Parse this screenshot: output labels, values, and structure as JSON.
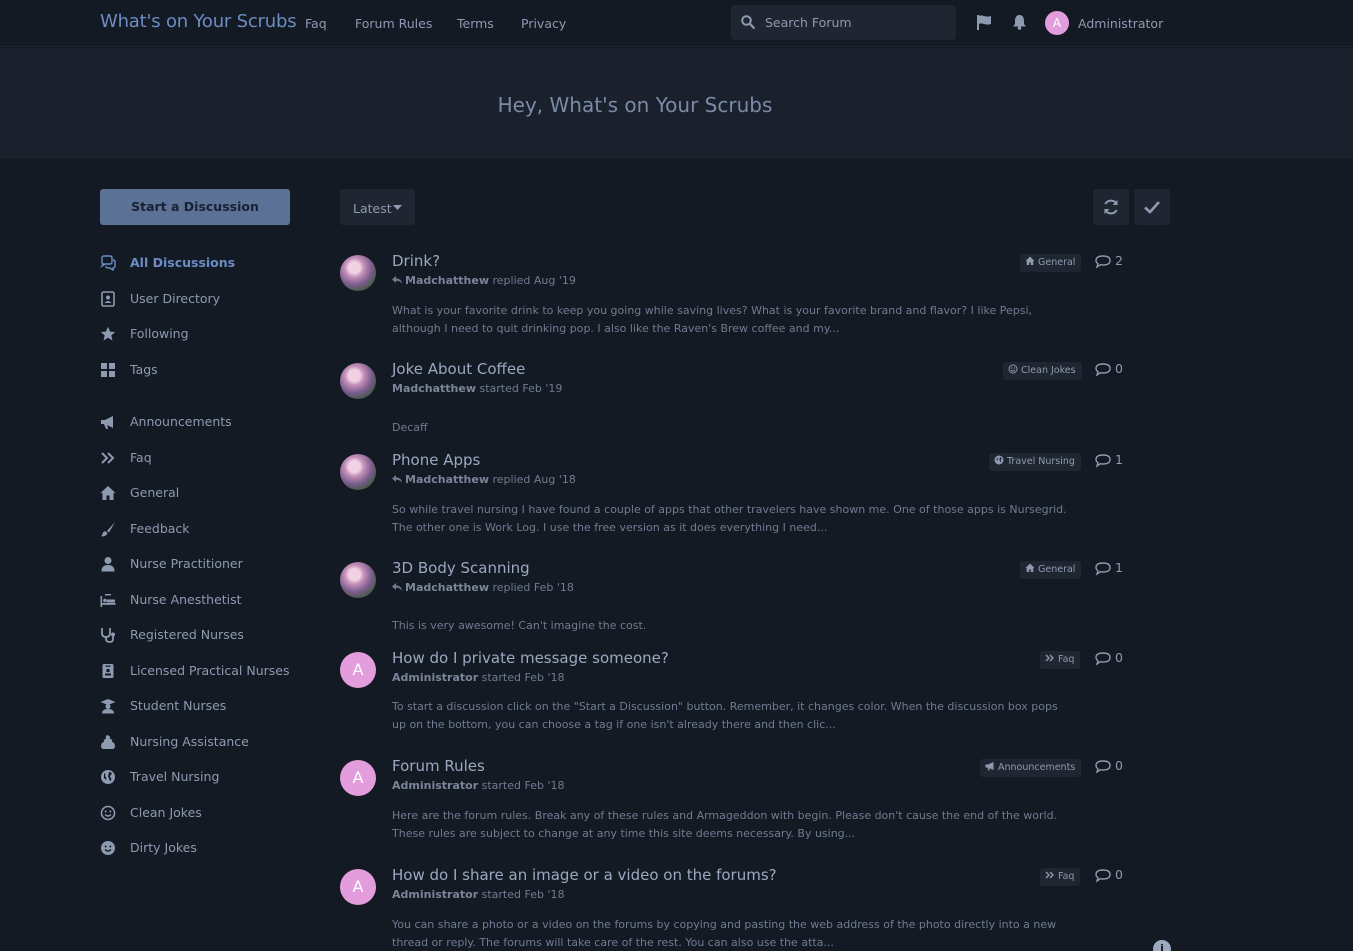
{
  "header": {
    "brand": "What's on Your Scrubs",
    "nav": [
      "Faq",
      "Forum Rules",
      "Terms",
      "Privacy"
    ],
    "search_placeholder": "Search Forum",
    "avatar_letter": "A",
    "user_name": "Administrator"
  },
  "hero": {
    "title": "Hey, What's on Your Scrubs"
  },
  "sidebar": {
    "start_button": "Start a Discussion",
    "items": [
      {
        "label": "All Discussions",
        "icon": "comments-icon"
      },
      {
        "label": "User Directory",
        "icon": "address-book-icon"
      },
      {
        "label": "Following",
        "icon": "star-icon"
      },
      {
        "label": "Tags",
        "icon": "grid-icon"
      },
      {
        "label": "Announcements",
        "icon": "bullhorn-icon"
      },
      {
        "label": "Faq",
        "icon": "angle-double-right-icon"
      },
      {
        "label": "General",
        "icon": "home-icon"
      },
      {
        "label": "Feedback",
        "icon": "paint-brush-icon"
      },
      {
        "label": "Nurse Practitioner",
        "icon": "user-md-icon"
      },
      {
        "label": "Nurse Anesthetist",
        "icon": "procedures-icon"
      },
      {
        "label": "Registered Nurses",
        "icon": "stethoscope-icon"
      },
      {
        "label": "Licensed Practical Nurses",
        "icon": "id-badge-icon"
      },
      {
        "label": "Student Nurses",
        "icon": "graduation-icon"
      },
      {
        "label": "Nursing Assistance",
        "icon": "poop-icon"
      },
      {
        "label": "Travel Nursing",
        "icon": "globe-icon"
      },
      {
        "label": "Clean Jokes",
        "icon": "smile-icon"
      },
      {
        "label": "Dirty Jokes",
        "icon": "smile-filled-icon"
      }
    ]
  },
  "toolbar": {
    "sort_label": "Latest"
  },
  "discussions": [
    {
      "title": "Drink?",
      "author": "Madchatthew",
      "action": "replied",
      "date": "Aug '19",
      "replied": true,
      "excerpt": "What is your favorite drink to keep you going while saving lives? What is your favorite brand and flavor? I like Pepsi, although I need to quit drinking pop. I also like the Raven's Brew coffee and my...",
      "tag": "General",
      "tag_icon": "home-icon",
      "comments": "2",
      "avatar": "photo"
    },
    {
      "title": "Joke About Coffee",
      "author": "Madchatthew",
      "action": "started",
      "date": "Feb '19",
      "replied": false,
      "excerpt": "Decaff",
      "tag": "Clean Jokes",
      "tag_icon": "smile-icon",
      "comments": "0",
      "avatar": "photo"
    },
    {
      "title": "Phone Apps",
      "author": "Madchatthew",
      "action": "replied",
      "date": "Aug '18",
      "replied": true,
      "excerpt": "So while travel nursing I have found a couple of apps that other travelers have shown me. One of those apps is Nursegrid. The other one is Work Log. I use the free version as it does everything I need...",
      "tag": "Travel Nursing",
      "tag_icon": "globe-icon",
      "comments": "1",
      "avatar": "photo"
    },
    {
      "title": "3D Body Scanning",
      "author": "Madchatthew",
      "action": "replied",
      "date": "Feb '18",
      "replied": true,
      "excerpt": "This is very awesome! Can't imagine the cost.",
      "tag": "General",
      "tag_icon": "home-icon",
      "comments": "1",
      "avatar": "photo"
    },
    {
      "title": "How do I private message someone?",
      "author": "Administrator",
      "action": "started",
      "date": "Feb '18",
      "replied": false,
      "excerpt": "To start a discussion click on the \"Start a Discussion\" button. Remember, it changes color. When the discussion box pops up on the bottom, you can choose a tag if one isn't already there and then clic...",
      "tag": "Faq",
      "tag_icon": "angle-double-right-icon",
      "comments": "0",
      "avatar": "A"
    },
    {
      "title": "Forum Rules",
      "author": "Administrator",
      "action": "started",
      "date": "Feb '18",
      "replied": false,
      "excerpt": "Here are the forum rules. Break any of these rules and Armageddon with begin. Please don't cause the end of the world. These rules are subject to change at any time this site deems necessary. By using...",
      "tag": "Announcements",
      "tag_icon": "bullhorn-icon",
      "comments": "0",
      "avatar": "A"
    },
    {
      "title": "How do I share an image or a video on the forums?",
      "author": "Administrator",
      "action": "started",
      "date": "Feb '18",
      "replied": false,
      "excerpt": "You can share a photo or a video on the forums by copying and pasting the web address of the photo directly into a new thread or reply. The forums will take care of the rest. You can also use the atta...",
      "tag": "Faq",
      "tag_icon": "angle-double-right-icon",
      "comments": "0",
      "avatar": "A"
    }
  ],
  "colors": {
    "background": "#141a24",
    "accent": "#6c8cc4",
    "avatar": "#e39ddc"
  }
}
